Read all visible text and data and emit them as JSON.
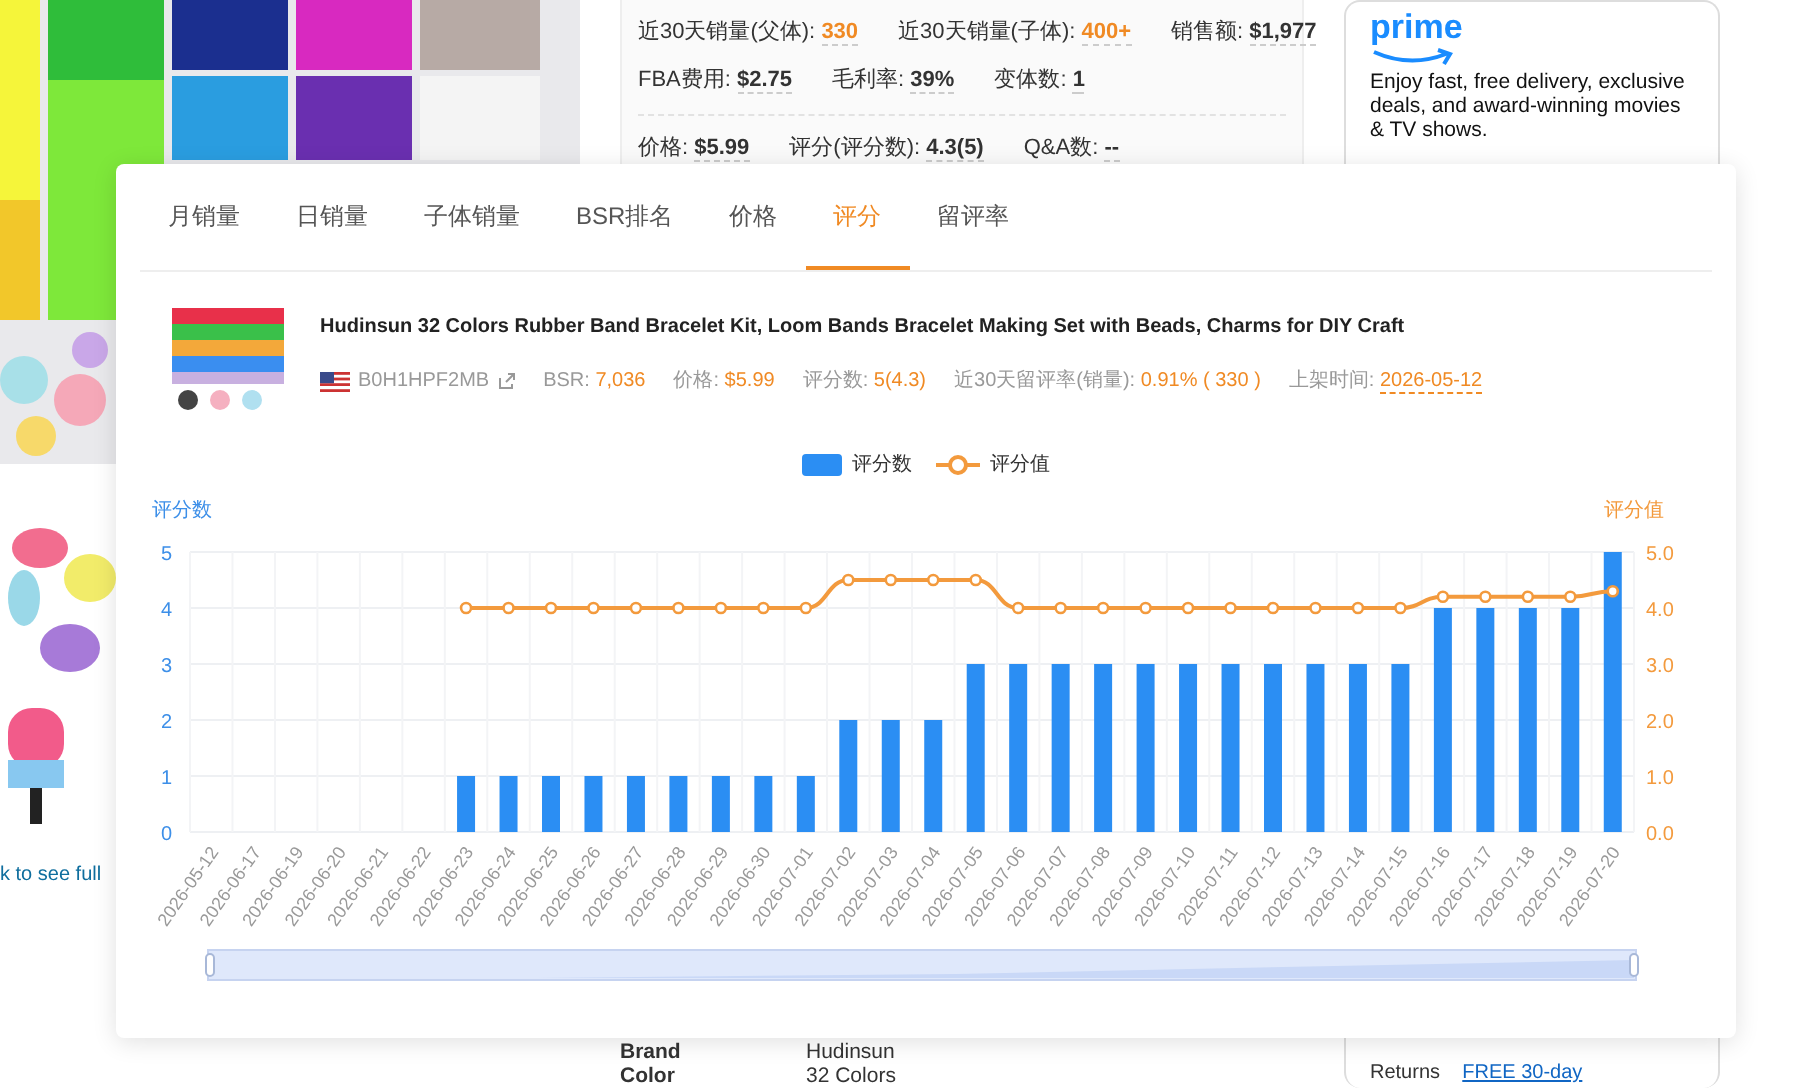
{
  "background_page": {
    "gallery_caption": "k to see full",
    "stat_groups": [
      {
        "lines": [
          {
            "stats": [
              {
                "label": "近30天销量(父体):",
                "value": "330",
                "highlight": true
              },
              {
                "label": "近30天销量(子体):",
                "value": "400+",
                "highlight": true
              },
              {
                "label": "销售额:",
                "value": "$1,977",
                "highlight": false
              }
            ]
          },
          {
            "stats": [
              {
                "label": "FBA费用:",
                "value": "$2.75",
                "highlight": false
              },
              {
                "label": "毛利率:",
                "value": "39%",
                "highlight": false
              },
              {
                "label": "变体数:",
                "value": "1",
                "highlight": false
              }
            ]
          }
        ]
      },
      {
        "lines": [
          {
            "stats": [
              {
                "label": "价格:",
                "value": "$5.99",
                "highlight": false
              },
              {
                "label": "评分(评分数):",
                "value": "4.3(5)",
                "highlight": false
              },
              {
                "label": "Q&A数:",
                "value": "--",
                "highlight": false
              }
            ]
          }
        ]
      }
    ],
    "prime_card": {
      "logo": "prime",
      "text": "Enjoy fast, free delivery, exclusive deals, and award-winning movies & TV shows."
    },
    "details": [
      {
        "label": "Brand",
        "value": "Hudinsun"
      },
      {
        "label": "Color",
        "value": "32 Colors"
      }
    ],
    "returns": {
      "label": "Returns",
      "value": "FREE 30-day"
    }
  },
  "popup": {
    "tabs": [
      {
        "label": "月销量",
        "selected": false
      },
      {
        "label": "日销量",
        "selected": false
      },
      {
        "label": "子体销量",
        "selected": false
      },
      {
        "label": "BSR排名",
        "selected": false
      },
      {
        "label": "价格",
        "selected": false
      },
      {
        "label": "评分",
        "selected": true
      },
      {
        "label": "留评率",
        "selected": false
      }
    ],
    "product": {
      "title": "Hudinsun 32 Colors Rubber Band Bracelet Kit, Loom Bands Bracelet Making Set with Beads, Charms for DIY Craft",
      "asin": "B0H1HPF2MB",
      "metrics": [
        {
          "label": "BSR:",
          "value": "7,036",
          "underlined": false
        },
        {
          "label": "价格:",
          "value": "$5.99",
          "underlined": false
        },
        {
          "label": "评分数:",
          "value": "5(4.3)",
          "underlined": false
        },
        {
          "label": "近30天留评率(销量):",
          "value": "0.91% ( 330 )",
          "underlined": false
        },
        {
          "label": "上架时间:",
          "value": "2026-05-12",
          "underlined": true
        }
      ]
    },
    "chart_data": {
      "type": "bar",
      "ylabel": "评分数",
      "y2label": "评分值",
      "categories": [
        "2026-05-12",
        "2026-06-17",
        "2026-06-19",
        "2026-06-20",
        "2026-06-21",
        "2026-06-22",
        "2026-06-23",
        "2026-06-24",
        "2026-06-25",
        "2026-06-26",
        "2026-06-27",
        "2026-06-28",
        "2026-06-29",
        "2026-06-30",
        "2026-07-01",
        "2026-07-02",
        "2026-07-03",
        "2026-07-04",
        "2026-07-05",
        "2026-07-06",
        "2026-07-07",
        "2026-07-08",
        "2026-07-09",
        "2026-07-10",
        "2026-07-11",
        "2026-07-12",
        "2026-07-13",
        "2026-07-14",
        "2026-07-15",
        "2026-07-16",
        "2026-07-17",
        "2026-07-18",
        "2026-07-19",
        "2026-07-20"
      ],
      "series": [
        {
          "name": "评分数",
          "type": "bar",
          "color": "#2b8ef3",
          "values": [
            null,
            null,
            null,
            null,
            null,
            null,
            1,
            1,
            1,
            1,
            1,
            1,
            1,
            1,
            1,
            2,
            2,
            2,
            3,
            3,
            3,
            3,
            3,
            3,
            3,
            3,
            3,
            3,
            3,
            4,
            4,
            4,
            4,
            5
          ]
        },
        {
          "name": "评分值",
          "type": "line",
          "color": "#f39a3d",
          "marker": "circle",
          "values": [
            null,
            null,
            null,
            null,
            null,
            null,
            4,
            4,
            4,
            4,
            4,
            4,
            4,
            4,
            4,
            4.5,
            4.5,
            4.5,
            4.5,
            4,
            4,
            4,
            4,
            4,
            4,
            4,
            4,
            4,
            4,
            4.2,
            4.2,
            4.2,
            4.2,
            4.3
          ]
        }
      ],
      "grid": true,
      "ylim": [
        0,
        5
      ],
      "y2lim": [
        0,
        5
      ],
      "yticks": [
        0,
        1,
        2,
        3,
        4,
        5
      ],
      "y2ticks": [
        {
          "value": 0,
          "label": "0.0"
        },
        {
          "value": 1,
          "label": "1.0"
        },
        {
          "value": 2,
          "label": "2.0"
        },
        {
          "value": 3,
          "label": "3.0"
        },
        {
          "value": 4,
          "label": "4.0"
        },
        {
          "value": 5,
          "label": "5.0"
        }
      ]
    }
  }
}
